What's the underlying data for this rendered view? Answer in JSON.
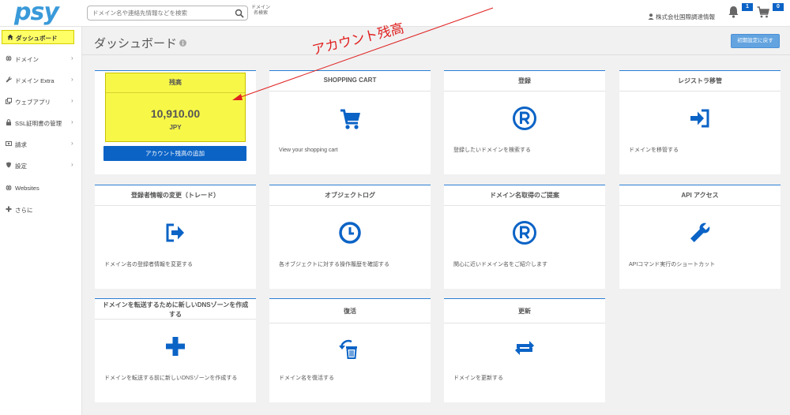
{
  "header": {
    "logo": "psy",
    "search_placeholder": "ドメイン名や連絡先情報などを検索",
    "search_label": "ドメイン名検索",
    "user_name": "株式会社国際調達情報",
    "notifications_count": "1",
    "cart_count": "0"
  },
  "sidebar": {
    "items": [
      {
        "label": "ダッシュボード",
        "icon": "home-icon"
      },
      {
        "label": "ドメイン",
        "icon": "globe-icon"
      },
      {
        "label": "ドメイン Extra",
        "icon": "wrench-icon"
      },
      {
        "label": "ウェブアプリ",
        "icon": "windows-icon"
      },
      {
        "label": "SSL証明書の管理",
        "icon": "lock-icon"
      },
      {
        "label": "請求",
        "icon": "money-icon"
      },
      {
        "label": "設定",
        "icon": "shield-icon"
      },
      {
        "label": "Websites",
        "icon": "globe-icon"
      },
      {
        "label": "さらに",
        "icon": "plus-icon"
      }
    ]
  },
  "main": {
    "page_title": "ダッシュボード",
    "setup_button": "初期設定に戻す",
    "annotation": "アカウント残高",
    "balance": {
      "title": "残高",
      "amount": "10,910.00",
      "currency": "JPY",
      "add_button": "アカウント残高の追加"
    },
    "cards": [
      {
        "title": "SHOPPING CART",
        "desc": "View your shopping cart",
        "icon": "shopping-cart-icon"
      },
      {
        "title": "登録",
        "desc": "登録したいドメインを検索する",
        "icon": "registered-icon"
      },
      {
        "title": "レジストラ移管",
        "desc": "ドメインを移管する",
        "icon": "transfer-icon"
      },
      {
        "title": "登録者情報の変更（トレード）",
        "desc": "ドメイン名の登録者情報を変更する",
        "icon": "trade-icon"
      },
      {
        "title": "オブジェクトログ",
        "desc": "各オブジェクトに対する操作履歴を確認する",
        "icon": "clock-icon"
      },
      {
        "title": "ドメイン名取得のご提案",
        "desc": "関心に近いドメイン名をご紹介します",
        "icon": "registered-icon"
      },
      {
        "title": "API アクセス",
        "desc": "APIコマンド実行のショートカット",
        "icon": "wrench-icon"
      },
      {
        "title": "ドメインを転送するために新しいDNSゾーンを作成する",
        "desc": "ドメインを転送する前に新しいDNSゾーンを作成する",
        "icon": "plus-icon"
      },
      {
        "title": "復活",
        "desc": "ドメイン名を復活する",
        "icon": "restore-icon"
      },
      {
        "title": "更新",
        "desc": "ドメインを更新する",
        "icon": "renew-icon"
      }
    ]
  },
  "colors": {
    "accent": "#0b63c6",
    "highlight": "#f7f748",
    "annotation": "#e02020"
  }
}
